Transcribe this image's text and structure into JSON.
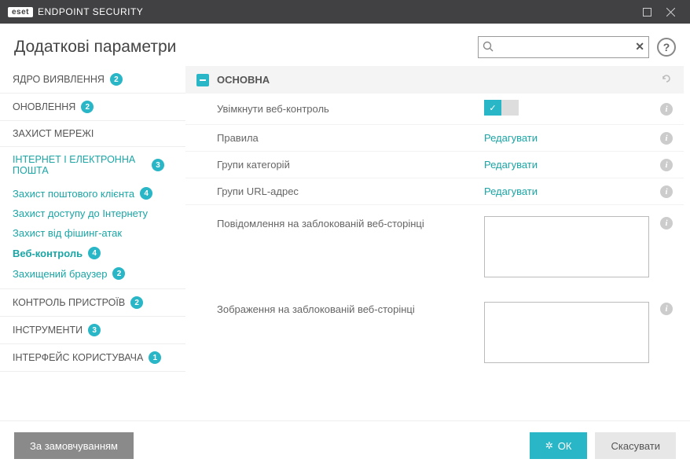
{
  "titlebar": {
    "brand": "eset",
    "product": "ENDPOINT SECURITY"
  },
  "header": {
    "title": "Додаткові параметри",
    "search_placeholder": "",
    "help": "?"
  },
  "sidebar": {
    "items": [
      {
        "label": "ЯДРО ВИЯВЛЕННЯ",
        "badge": "2"
      },
      {
        "label": "ОНОВЛЕННЯ",
        "badge": "2"
      },
      {
        "label": "ЗАХИСТ МЕРЕЖІ"
      },
      {
        "label": "ІНТЕРНЕТ І ЕЛЕКТРОННА ПОШТА",
        "badge": "3"
      },
      {
        "label": "КОНТРОЛЬ ПРИСТРОЇВ",
        "badge": "2"
      },
      {
        "label": "ІНСТРУМЕНТИ",
        "badge": "3"
      },
      {
        "label": "ІНТЕРФЕЙС КОРИСТУВАЧА",
        "badge": "1"
      }
    ],
    "subs": [
      {
        "label": "Захист поштового клієнта",
        "badge": "4"
      },
      {
        "label": "Захист доступу до Інтернету"
      },
      {
        "label": "Захист від фішинг-атак"
      },
      {
        "label": "Веб-контроль",
        "badge": "4"
      },
      {
        "label": "Захищений браузер",
        "badge": "2"
      }
    ]
  },
  "section": {
    "title": "ОСНОВНА",
    "rows": {
      "enable": {
        "label": "Увімкнути веб-контроль"
      },
      "rules": {
        "label": "Правила",
        "action": "Редагувати"
      },
      "catgroups": {
        "label": "Групи категорій",
        "action": "Редагувати"
      },
      "urlgroups": {
        "label": "Групи URL-адрес",
        "action": "Редагувати"
      },
      "blockmsg": {
        "label": "Повідомлення на заблокованій веб-сторінці"
      },
      "blockimg": {
        "label": "Зображення на заблокованій веб-сторінці"
      }
    }
  },
  "footer": {
    "default": "За замовчуванням",
    "ok": "ОК",
    "cancel": "Скасувати"
  }
}
